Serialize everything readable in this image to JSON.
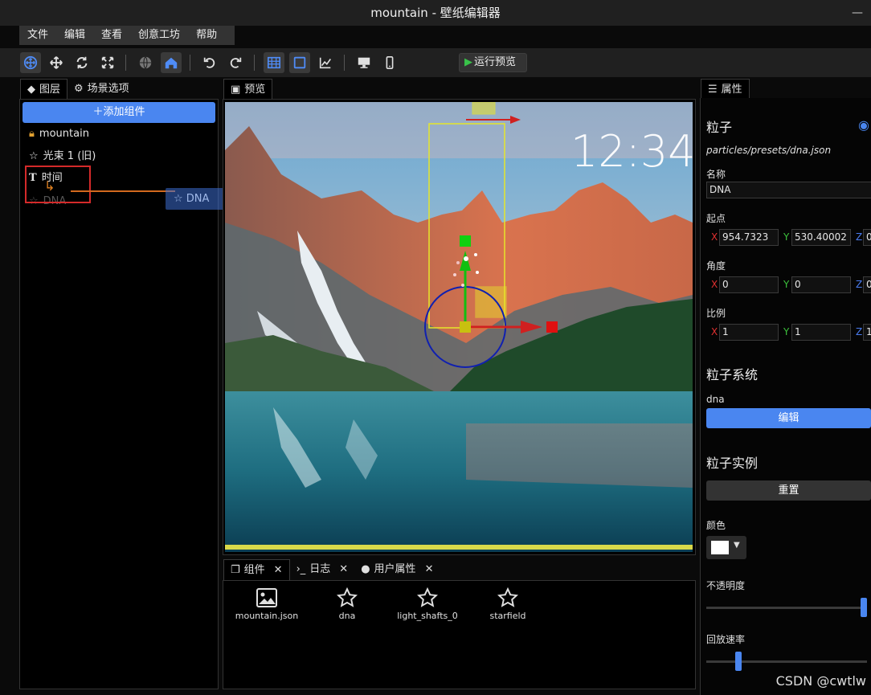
{
  "window": {
    "title": "mountain - 壁纸编辑器",
    "min_glyph": "—"
  },
  "menu": [
    "文件",
    "编辑",
    "查看",
    "创意工坊",
    "帮助"
  ],
  "toolbar": {
    "run_preview": "运行预览"
  },
  "layers_panel": {
    "tabs": [
      "图层",
      "场景选项"
    ],
    "add_button": "添加组件",
    "items": [
      {
        "label": "mountain",
        "icon": "lock-icon"
      },
      {
        "label": "光束 1 (旧)",
        "icon": "star-icon"
      },
      {
        "label": "时间",
        "icon": "text-icon"
      },
      {
        "label": "DNA",
        "icon": "star-icon"
      }
    ],
    "drag_ghost_label": "DNA"
  },
  "preview": {
    "tab": "预览",
    "clock_text": "12:34"
  },
  "bottom_panel": {
    "tabs": [
      "组件",
      "日志",
      "用户属性"
    ],
    "items": [
      {
        "label": "mountain.json",
        "icon": "image-icon"
      },
      {
        "label": "dna",
        "icon": "star-icon"
      },
      {
        "label": "light_shafts_0",
        "icon": "star-icon"
      },
      {
        "label": "starfield",
        "icon": "star-icon"
      }
    ]
  },
  "properties": {
    "tab": "属性",
    "heading": "粒子",
    "path": "particles/presets/dna.json",
    "name_label": "名称",
    "name_value": "DNA",
    "origin_label": "起点",
    "origin": {
      "x": "954.7323",
      "y": "530.40002",
      "z": "0"
    },
    "angle_label": "角度",
    "angle": {
      "x": "0",
      "y": "0",
      "z": "0"
    },
    "scale_label": "比例",
    "scale": {
      "x": "1",
      "y": "1",
      "z": "1"
    },
    "system_heading": "粒子系统",
    "system_name": "dna",
    "edit_button": "编辑",
    "instance_heading": "粒子实例",
    "reset_button": "重置",
    "color_label": "颜色",
    "color_value": "#ffffff",
    "opacity_label": "不透明度",
    "opacity": 0.98,
    "playback_label": "回放速率",
    "playback_rate": 0.2
  },
  "colors": {
    "accent": "#4a86f0",
    "axis_x": "#e03030",
    "axis_y": "#3cc03c",
    "axis_z": "#4a7cf0"
  },
  "watermark": "CSDN @cwtlw"
}
